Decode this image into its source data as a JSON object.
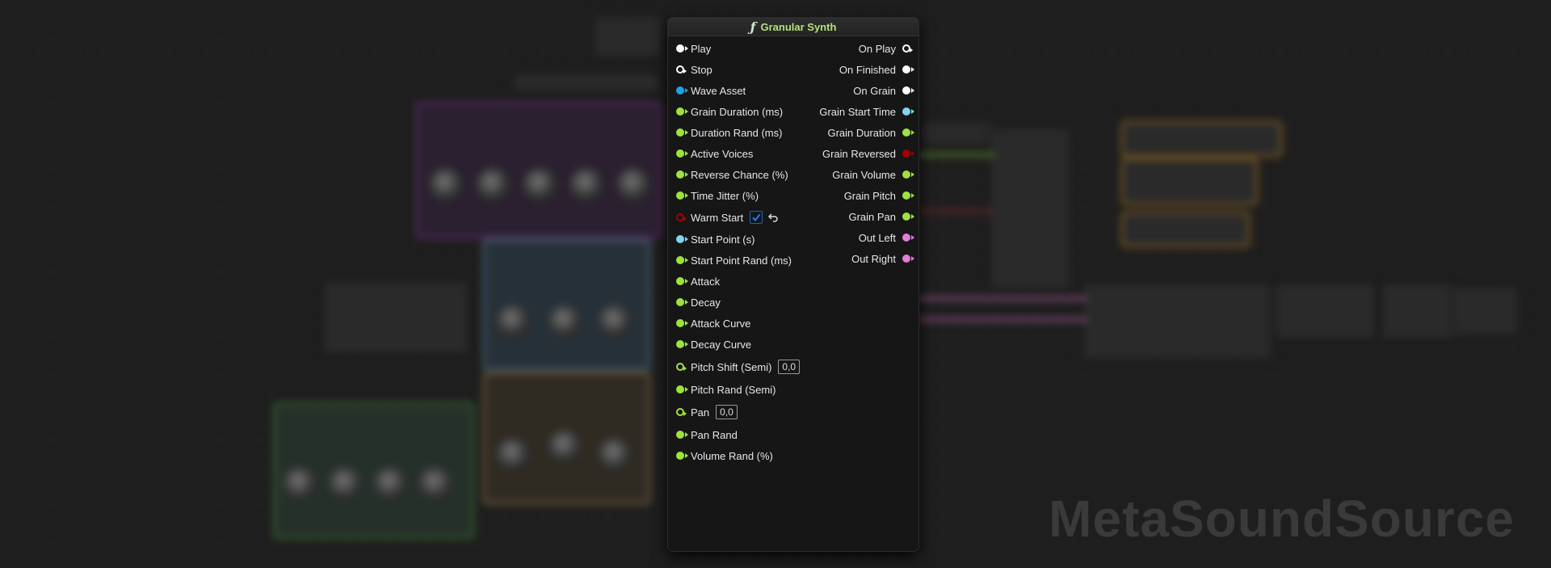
{
  "node": {
    "title": "Granular Synth",
    "icon": "function-icon",
    "inputs": [
      {
        "label": "Play",
        "type": "trigger",
        "color": "#ffffff",
        "hollow": false
      },
      {
        "label": "Stop",
        "type": "trigger",
        "color": "#ffffff",
        "hollow": true
      },
      {
        "label": "Wave Asset",
        "type": "object",
        "color": "#1aa3e8",
        "hollow": false
      },
      {
        "label": "Grain Duration (ms)",
        "type": "float",
        "color": "#9ee33c",
        "hollow": false
      },
      {
        "label": "Duration Rand (ms)",
        "type": "float",
        "color": "#9ee33c",
        "hollow": false
      },
      {
        "label": "Active Voices",
        "type": "float",
        "color": "#9ee33c",
        "hollow": false
      },
      {
        "label": "Reverse Chance (%)",
        "type": "float",
        "color": "#9ee33c",
        "hollow": false
      },
      {
        "label": "Time Jitter (%)",
        "type": "float",
        "color": "#9ee33c",
        "hollow": false
      },
      {
        "label": "Warm Start",
        "type": "bool",
        "color": "#a00000",
        "hollow": true,
        "checked": true
      },
      {
        "label": "Start Point (s)",
        "type": "time",
        "color": "#7ed6f0",
        "hollow": false
      },
      {
        "label": "Start Point Rand (ms)",
        "type": "float",
        "color": "#9ee33c",
        "hollow": false
      },
      {
        "label": "Attack",
        "type": "float",
        "color": "#9ee33c",
        "hollow": false
      },
      {
        "label": "Decay",
        "type": "float",
        "color": "#9ee33c",
        "hollow": false
      },
      {
        "label": "Attack Curve",
        "type": "float",
        "color": "#9ee33c",
        "hollow": false
      },
      {
        "label": "Decay Curve",
        "type": "float",
        "color": "#9ee33c",
        "hollow": false
      },
      {
        "label": "Pitch Shift (Semi)",
        "type": "float",
        "color": "#9ee33c",
        "hollow": true,
        "value": "0,0"
      },
      {
        "label": "Pitch Rand (Semi)",
        "type": "float",
        "color": "#9ee33c",
        "hollow": false
      },
      {
        "label": "Pan",
        "type": "float",
        "color": "#9ee33c",
        "hollow": true,
        "value": "0,0"
      },
      {
        "label": "Pan Rand",
        "type": "float",
        "color": "#9ee33c",
        "hollow": false
      },
      {
        "label": "Volume Rand (%)",
        "type": "float",
        "color": "#9ee33c",
        "hollow": false
      }
    ],
    "outputs": [
      {
        "label": "On Play",
        "type": "trigger",
        "color": "#ffffff",
        "hollow": true
      },
      {
        "label": "On Finished",
        "type": "trigger",
        "color": "#ffffff",
        "hollow": false
      },
      {
        "label": "On Grain",
        "type": "trigger",
        "color": "#ffffff",
        "hollow": false
      },
      {
        "label": "Grain Start Time",
        "type": "time",
        "color": "#7ed6f0",
        "hollow": false
      },
      {
        "label": "Grain Duration",
        "type": "float",
        "color": "#9ee33c",
        "hollow": false
      },
      {
        "label": "Grain Reversed",
        "type": "bool",
        "color": "#a00000",
        "hollow": false
      },
      {
        "label": "Grain Volume",
        "type": "float",
        "color": "#9ee33c",
        "hollow": false
      },
      {
        "label": "Grain Pitch",
        "type": "float",
        "color": "#9ee33c",
        "hollow": false
      },
      {
        "label": "Grain Pan",
        "type": "float",
        "color": "#9ee33c",
        "hollow": false
      },
      {
        "label": "Out Left",
        "type": "audio",
        "color": "#e67bd8",
        "hollow": false
      },
      {
        "label": "Out Right",
        "type": "audio",
        "color": "#e67bd8",
        "hollow": false
      }
    ]
  },
  "watermark": "MetaSoundSource",
  "colors": {
    "trigger": "#ffffff",
    "float": "#9ee33c",
    "object": "#1aa3e8",
    "bool": "#a00000",
    "time": "#7ed6f0",
    "audio": "#e67bd8",
    "title": "#b6e07a",
    "checkbox": "#2b7be0"
  }
}
